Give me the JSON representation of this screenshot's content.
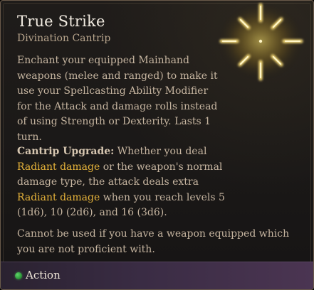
{
  "spell": {
    "name": "True Strike",
    "school": "Divination Cantrip",
    "icon": "true-strike-crosshair-icon",
    "description": "Enchant your equipped Mainhand weapons (melee and ranged) to make it use your Spellcasting Ability Modifier for the Attack and damage rolls instead of using Strength or Dexterity. Lasts 1 turn.",
    "upgrade": {
      "label": "Cantrip Upgrade:",
      "text_1": " Whether you deal ",
      "highlight_1": "Radiant damage",
      "text_2": " or the weapon's normal damage type, the attack deals extra ",
      "highlight_2": "Radiant damage",
      "text_3": " when you reach levels 5 (1d6), 10 (2d6), and 16 (3d6)."
    },
    "note": "Cannot be used if you have a weapon equipped which you are not proficient with."
  },
  "footer": {
    "action_label": "Action",
    "action_icon": "action-dot-icon"
  },
  "colors": {
    "highlight": "#e6b33a",
    "body_text": "#c6b5a0",
    "title": "#f1ebe1",
    "action_green": "#2e9a3a"
  }
}
